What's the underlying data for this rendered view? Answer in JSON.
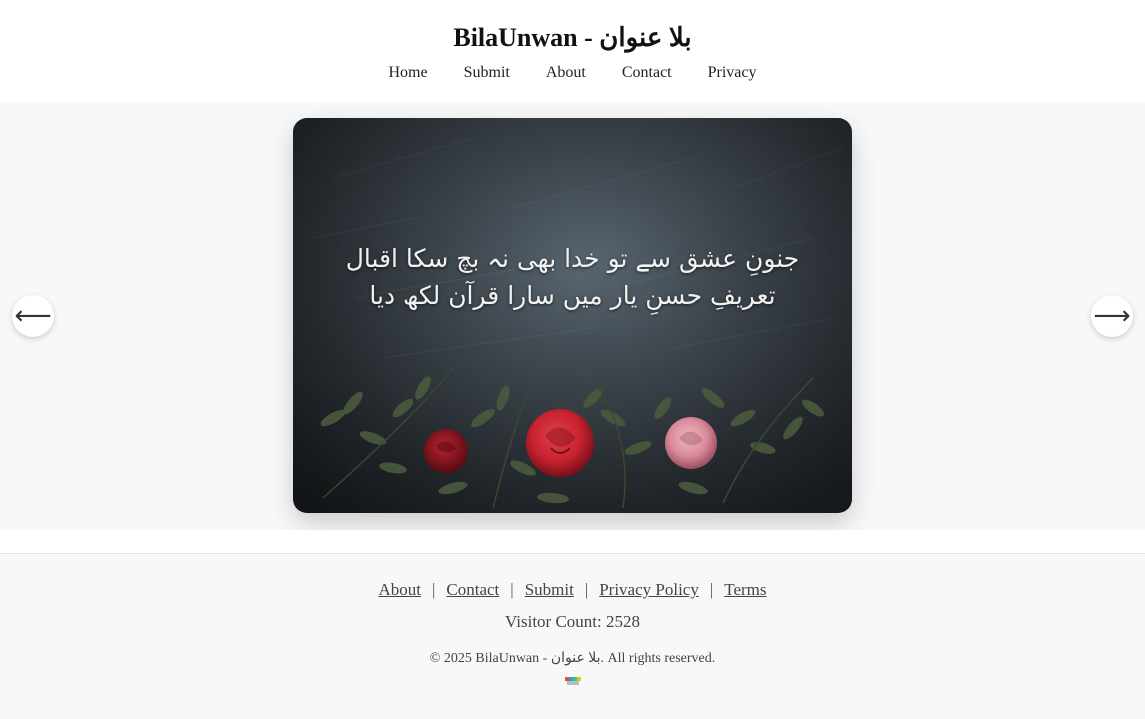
{
  "site": {
    "title": "BilaUnwan - بلا عنوان"
  },
  "nav": {
    "items": [
      "Home",
      "Submit",
      "About",
      "Contact",
      "Privacy"
    ]
  },
  "carousel": {
    "poem_line_1": "جنونِ عشق سے تو خدا بھی نہ بچ سکا اقبال",
    "poem_line_2": "تعریفِ حسنِ یار میں سارا قرآن لکھ دیا",
    "prev_icon": "arrow-left-icon",
    "next_icon": "arrow-right-icon",
    "prev_glyph": "⟵",
    "next_glyph": "⟶"
  },
  "footer": {
    "links": [
      "About",
      "Contact",
      "Submit",
      "Privacy Policy",
      "Terms"
    ],
    "separator": "|",
    "visitor_count": "Visitor Count: 2528",
    "copyright": "© 2025 BilaUnwan - بلا عنوان. All rights reserved."
  },
  "colors": {
    "page_bg": "#ffffff",
    "band_bg": "#f7f8fa",
    "slide_bg": "#424b53",
    "rose_red": "#c8232f",
    "rose_dark": "#8f1420",
    "rose_pink": "#d98a9a",
    "leaf_green": "#4a5a3e"
  }
}
